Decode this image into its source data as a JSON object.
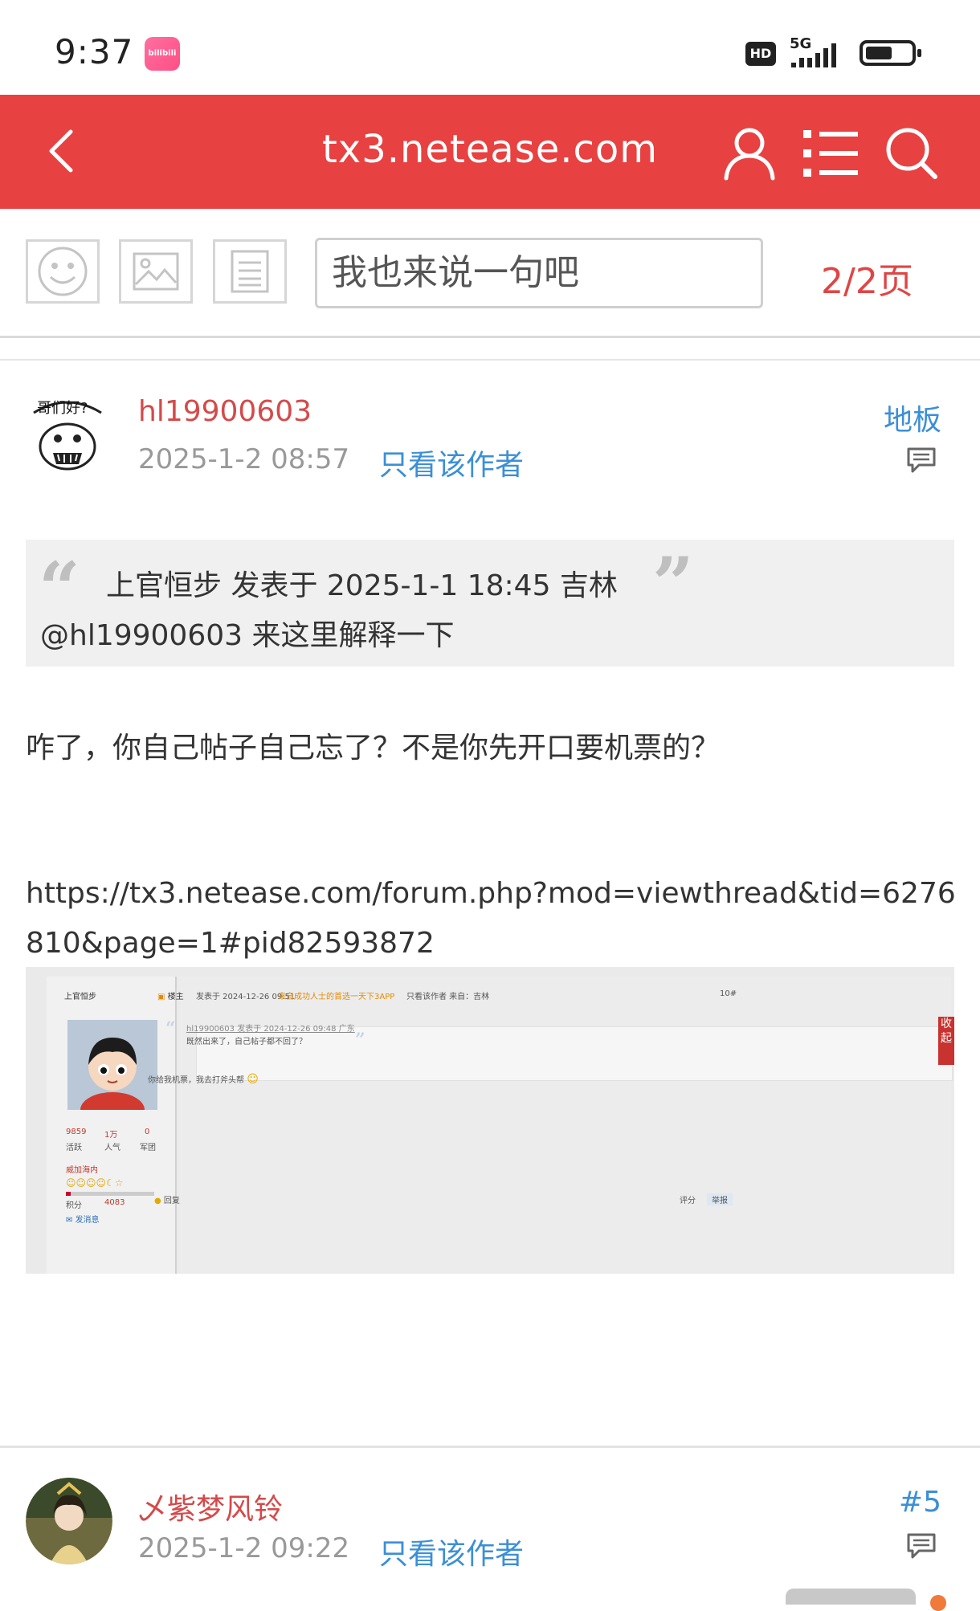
{
  "status": {
    "time": "9:37",
    "app_badge": "bilibili",
    "hd": "HD",
    "network": "5G",
    "battery_level": 0.6
  },
  "nav": {
    "title": "tx3.netease.com"
  },
  "toolbar": {
    "reply_placeholder": "我也来说一句吧",
    "page_indicator": "2/2页"
  },
  "post1": {
    "username": "hl19900603",
    "time": "2025-1-2 08:57",
    "author_only": "只看该作者",
    "floor": "地板",
    "quote_meta": "上官恒步 发表于 2025-1-1 18:45 吉林",
    "quote_text": "@hl19900603 来这里解释一下",
    "body": "咋了，你自己帖子自己忘了？不是你先开口要机票的？",
    "link": "https://tx3.netease.com/forum.php?mod=viewthread&tid=6276810&page=1#pid82593872"
  },
  "screenshot": {
    "name": "上官恒步",
    "stats": [
      "9859",
      "1万",
      "0"
    ],
    "stat_labels": [
      "活跃",
      "人气",
      "军团"
    ],
    "tag": "威加海内",
    "score_label": "积分",
    "score": "4083",
    "message": "发消息",
    "header_label": "楼主",
    "header_time": "发表于 2024-12-26 09:51",
    "header_link": "来自成功人士的首选一天下3APP",
    "header_only": "只看该作者 来自：吉林",
    "floor_no": "10#",
    "quote_line1": "hl19900603 发表于 2024-12-26 09:48 广东",
    "quote_line2": "既然出来了，自己帖子都不回了？",
    "content": "你给我机票，我去打斧头帮",
    "reply": "回复",
    "rate": "评分",
    "report": "举报",
    "collapse": "收起"
  },
  "post2": {
    "username": "乄紫梦风铃",
    "time": "2025-1-2 09:22",
    "author_only": "只看该作者",
    "floor": "#5"
  },
  "colors": {
    "brand_red": "#e84141",
    "link_blue": "#3c8fd6",
    "name_red": "#d44a4a"
  }
}
